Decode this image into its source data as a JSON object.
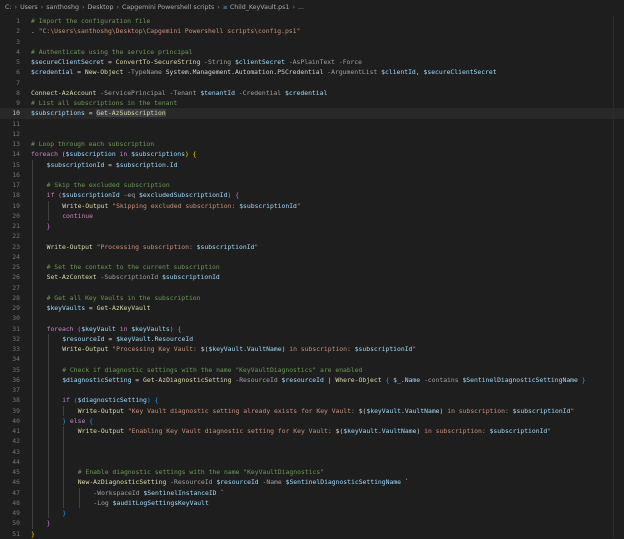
{
  "breadcrumb": {
    "segments": [
      "C:",
      "Users",
      "santhoshg",
      "Desktop",
      "Capgemini Powershell scripts"
    ],
    "file": "Child_KeyVault.ps1",
    "tail": "..."
  },
  "colors": {
    "background": "#1e1e1e",
    "comment": "#6a9955",
    "string": "#ce9178",
    "variable": "#9cdcfe",
    "keyword": "#c586c0",
    "cmdlet": "#dcdcaa"
  },
  "editor": {
    "active_line": 10,
    "lines": [
      {
        "n": "1",
        "indent": 0,
        "tokens": [
          [
            "c",
            "# Import the configuration file"
          ]
        ]
      },
      {
        "n": "2",
        "indent": 0,
        "tokens": [
          [
            "op",
            ". "
          ],
          [
            "s",
            "\"C:\\Users\\santhoshg\\Desktop\\Capgemini Powershell scripts\\config.ps1\""
          ]
        ]
      },
      {
        "n": "3",
        "indent": 0,
        "tokens": []
      },
      {
        "n": "4",
        "indent": 0,
        "tokens": [
          [
            "c",
            "# Authenticate using the service principal"
          ]
        ]
      },
      {
        "n": "5",
        "indent": 0,
        "tokens": [
          [
            "v",
            "$secureClientSecret"
          ],
          [
            "op",
            " = "
          ],
          [
            "f",
            "ConvertTo-SecureString"
          ],
          [
            "p",
            " -String "
          ],
          [
            "v",
            "$clientSecret"
          ],
          [
            "p",
            " -AsPlainText -Force"
          ]
        ]
      },
      {
        "n": "6",
        "indent": 0,
        "tokens": [
          [
            "v",
            "$credential"
          ],
          [
            "op",
            " = "
          ],
          [
            "f",
            "New-Object"
          ],
          [
            "p",
            " -TypeName "
          ],
          [
            "op",
            "System.Management.Automation.PSCredential"
          ],
          [
            "p",
            " -ArgumentList "
          ],
          [
            "v",
            "$clientId"
          ],
          [
            "op",
            ", "
          ],
          [
            "v",
            "$secureClientSecret"
          ]
        ]
      },
      {
        "n": "7",
        "indent": 0,
        "tokens": []
      },
      {
        "n": "8",
        "indent": 0,
        "tokens": [
          [
            "f",
            "Connect-AzAccount"
          ],
          [
            "p",
            " -ServicePrincipal -Tenant "
          ],
          [
            "v",
            "$tenantId"
          ],
          [
            "p",
            " -Credential "
          ],
          [
            "v",
            "$credential"
          ]
        ]
      },
      {
        "n": "9",
        "indent": 0,
        "tokens": [
          [
            "c",
            "# List all subscriptions in the tenant"
          ]
        ]
      },
      {
        "n": "10",
        "indent": 0,
        "tokens": [
          [
            "v",
            "$subscriptions"
          ],
          [
            "op",
            " = "
          ],
          [
            "f hl",
            "Get-AzSubscription"
          ]
        ]
      },
      {
        "n": "11",
        "indent": 0,
        "tokens": []
      },
      {
        "n": "12",
        "indent": 0,
        "tokens": []
      },
      {
        "n": "13",
        "indent": 0,
        "tokens": [
          [
            "c",
            "# Loop through each subscription"
          ]
        ]
      },
      {
        "n": "14",
        "indent": 0,
        "tokens": [
          [
            "k",
            "foreach"
          ],
          [
            "op",
            " "
          ],
          [
            "b1",
            "("
          ],
          [
            "v",
            "$subscription"
          ],
          [
            "k",
            " in "
          ],
          [
            "v",
            "$subscriptions"
          ],
          [
            "b1",
            ")"
          ],
          [
            "op",
            " "
          ],
          [
            "b1",
            "{"
          ]
        ]
      },
      {
        "n": "15",
        "indent": 1,
        "tokens": [
          [
            "v",
            "$subscriptionId"
          ],
          [
            "op",
            " = "
          ],
          [
            "v",
            "$subscription"
          ],
          [
            "op",
            "."
          ],
          [
            "v",
            "Id"
          ]
        ]
      },
      {
        "n": "16",
        "indent": 1,
        "tokens": []
      },
      {
        "n": "17",
        "indent": 1,
        "tokens": [
          [
            "c",
            "# Skip the excluded subscription"
          ]
        ]
      },
      {
        "n": "18",
        "indent": 1,
        "tokens": [
          [
            "k",
            "if"
          ],
          [
            "op",
            " "
          ],
          [
            "b2",
            "("
          ],
          [
            "v",
            "$subscriptionId"
          ],
          [
            "p",
            " -eq "
          ],
          [
            "v",
            "$excludedSubscriptionId"
          ],
          [
            "b2",
            ")"
          ],
          [
            "op",
            " "
          ],
          [
            "b2",
            "{"
          ]
        ]
      },
      {
        "n": "19",
        "indent": 2,
        "tokens": [
          [
            "f",
            "Write-Output"
          ],
          [
            "op",
            " "
          ],
          [
            "s",
            "\"Skipping excluded subscription: "
          ],
          [
            "v",
            "$subscriptionId"
          ],
          [
            "s",
            "\""
          ]
        ]
      },
      {
        "n": "20",
        "indent": 2,
        "tokens": [
          [
            "k",
            "continue"
          ]
        ]
      },
      {
        "n": "21",
        "indent": 1,
        "tokens": [
          [
            "b2",
            "}"
          ]
        ]
      },
      {
        "n": "22",
        "indent": 1,
        "tokens": []
      },
      {
        "n": "23",
        "indent": 1,
        "tokens": [
          [
            "f",
            "Write-Output"
          ],
          [
            "op",
            " "
          ],
          [
            "s",
            "\"Processing subscription: "
          ],
          [
            "v",
            "$subscriptionId"
          ],
          [
            "s",
            "\""
          ]
        ]
      },
      {
        "n": "24",
        "indent": 1,
        "tokens": []
      },
      {
        "n": "25",
        "indent": 1,
        "tokens": [
          [
            "c",
            "# Set the context to the current subscription"
          ]
        ]
      },
      {
        "n": "26",
        "indent": 1,
        "tokens": [
          [
            "f",
            "Set-AzContext"
          ],
          [
            "p",
            " -SubscriptionId "
          ],
          [
            "v",
            "$subscriptionId"
          ]
        ]
      },
      {
        "n": "27",
        "indent": 1,
        "tokens": []
      },
      {
        "n": "28",
        "indent": 1,
        "tokens": [
          [
            "c",
            "# Get all Key Vaults in the subscription"
          ]
        ]
      },
      {
        "n": "29",
        "indent": 1,
        "tokens": [
          [
            "v",
            "$keyVaults"
          ],
          [
            "op",
            " = "
          ],
          [
            "f",
            "Get-AzKeyVault"
          ]
        ]
      },
      {
        "n": "30",
        "indent": 1,
        "tokens": []
      },
      {
        "n": "31",
        "indent": 1,
        "tokens": [
          [
            "k",
            "foreach"
          ],
          [
            "op",
            " "
          ],
          [
            "b2",
            "("
          ],
          [
            "v",
            "$keyVault"
          ],
          [
            "k",
            " in "
          ],
          [
            "v",
            "$keyVaults"
          ],
          [
            "b2",
            ")"
          ],
          [
            "op",
            " "
          ],
          [
            "b2",
            "{"
          ]
        ]
      },
      {
        "n": "32",
        "indent": 2,
        "tokens": [
          [
            "v",
            "$resourceId"
          ],
          [
            "op",
            " = "
          ],
          [
            "v",
            "$keyVault"
          ],
          [
            "op",
            "."
          ],
          [
            "v",
            "ResourceId"
          ]
        ]
      },
      {
        "n": "33",
        "indent": 2,
        "tokens": [
          [
            "f",
            "Write-Output"
          ],
          [
            "op",
            " "
          ],
          [
            "s",
            "\"Processing Key Vault: "
          ],
          [
            "op",
            "$("
          ],
          [
            "v",
            "$keyVault"
          ],
          [
            "op",
            "."
          ],
          [
            "v",
            "VaultName"
          ],
          [
            "op",
            ")"
          ],
          [
            "s",
            " in subscription: "
          ],
          [
            "v",
            "$subscriptionId"
          ],
          [
            "s",
            "\""
          ]
        ]
      },
      {
        "n": "34",
        "indent": 2,
        "tokens": []
      },
      {
        "n": "35",
        "indent": 2,
        "tokens": [
          [
            "c",
            "# Check if diagnostic settings with the name \"KeyVaultDiagnostics\" are enabled"
          ]
        ]
      },
      {
        "n": "36",
        "indent": 2,
        "tokens": [
          [
            "v",
            "$diagnosticSetting"
          ],
          [
            "op",
            " = "
          ],
          [
            "f",
            "Get-AzDiagnosticSetting"
          ],
          [
            "p",
            " -ResourceId "
          ],
          [
            "v",
            "$resourceId"
          ],
          [
            "op",
            " | "
          ],
          [
            "f",
            "Where-Object"
          ],
          [
            "op",
            " "
          ],
          [
            "b3",
            "{"
          ],
          [
            "op",
            " "
          ],
          [
            "v",
            "$_"
          ],
          [
            "op",
            "."
          ],
          [
            "v",
            "Name"
          ],
          [
            "p",
            " -contains "
          ],
          [
            "v",
            "$SentinelDiagnosticSettingName"
          ],
          [
            "op",
            " "
          ],
          [
            "b3",
            "}"
          ]
        ]
      },
      {
        "n": "37",
        "indent": 2,
        "tokens": []
      },
      {
        "n": "38",
        "indent": 2,
        "tokens": [
          [
            "k",
            "if"
          ],
          [
            "op",
            " "
          ],
          [
            "b3",
            "("
          ],
          [
            "v",
            "$diagnosticSetting"
          ],
          [
            "b3",
            ")"
          ],
          [
            "op",
            " "
          ],
          [
            "b3",
            "{"
          ]
        ]
      },
      {
        "n": "39",
        "indent": 3,
        "tokens": [
          [
            "f",
            "Write-Output"
          ],
          [
            "op",
            " "
          ],
          [
            "s",
            "\"Key Vault diagnostic setting already exists for Key Vault: "
          ],
          [
            "op",
            "$("
          ],
          [
            "v",
            "$keyVault"
          ],
          [
            "op",
            "."
          ],
          [
            "v",
            "VaultName"
          ],
          [
            "op",
            ")"
          ],
          [
            "s",
            " in subscription: "
          ],
          [
            "v",
            "$subscriptionId"
          ],
          [
            "s",
            "\""
          ]
        ]
      },
      {
        "n": "40",
        "indent": 2,
        "tokens": [
          [
            "b3",
            "}"
          ],
          [
            "op",
            " "
          ],
          [
            "k",
            "else"
          ],
          [
            "op",
            " "
          ],
          [
            "b3",
            "{"
          ]
        ]
      },
      {
        "n": "41",
        "indent": 3,
        "tokens": [
          [
            "f",
            "Write-Output"
          ],
          [
            "op",
            " "
          ],
          [
            "s",
            "\"Enabling Key Vault diagnostic setting for Key Vault: "
          ],
          [
            "op",
            "$("
          ],
          [
            "v",
            "$keyVault"
          ],
          [
            "op",
            "."
          ],
          [
            "v",
            "VaultName"
          ],
          [
            "op",
            ")"
          ],
          [
            "s",
            " in subscription: "
          ],
          [
            "v",
            "$subscriptionId"
          ],
          [
            "s",
            "\""
          ]
        ]
      },
      {
        "n": "42",
        "indent": 3,
        "tokens": []
      },
      {
        "n": "43",
        "indent": 3,
        "tokens": []
      },
      {
        "n": "44",
        "indent": 3,
        "tokens": []
      },
      {
        "n": "45",
        "indent": 3,
        "tokens": [
          [
            "c",
            "# Enable diagnostic settings with the name \"KeyVaultDiagnostics\""
          ]
        ]
      },
      {
        "n": "46",
        "indent": 3,
        "tokens": [
          [
            "f",
            "New-AzDiagnosticSetting"
          ],
          [
            "p",
            " -ResourceId "
          ],
          [
            "v",
            "$resourceId"
          ],
          [
            "p",
            " -Name "
          ],
          [
            "v",
            "$SentinelDiagnosticSettingName"
          ],
          [
            "op",
            " `"
          ]
        ]
      },
      {
        "n": "47",
        "indent": 4,
        "tokens": [
          [
            "p",
            "-WorkspaceId "
          ],
          [
            "v",
            "$SentinelInstanceID"
          ],
          [
            "op",
            " `"
          ]
        ]
      },
      {
        "n": "48",
        "indent": 4,
        "tokens": [
          [
            "p",
            "-Log "
          ],
          [
            "v",
            "$auditLogSettingsKeyVault"
          ]
        ]
      },
      {
        "n": "49",
        "indent": 2,
        "tokens": [
          [
            "b3",
            "}"
          ]
        ]
      },
      {
        "n": "50",
        "indent": 1,
        "tokens": [
          [
            "b2",
            "}"
          ]
        ]
      },
      {
        "n": "51",
        "indent": 0,
        "tokens": [
          [
            "b1",
            "}"
          ]
        ]
      }
    ]
  }
}
